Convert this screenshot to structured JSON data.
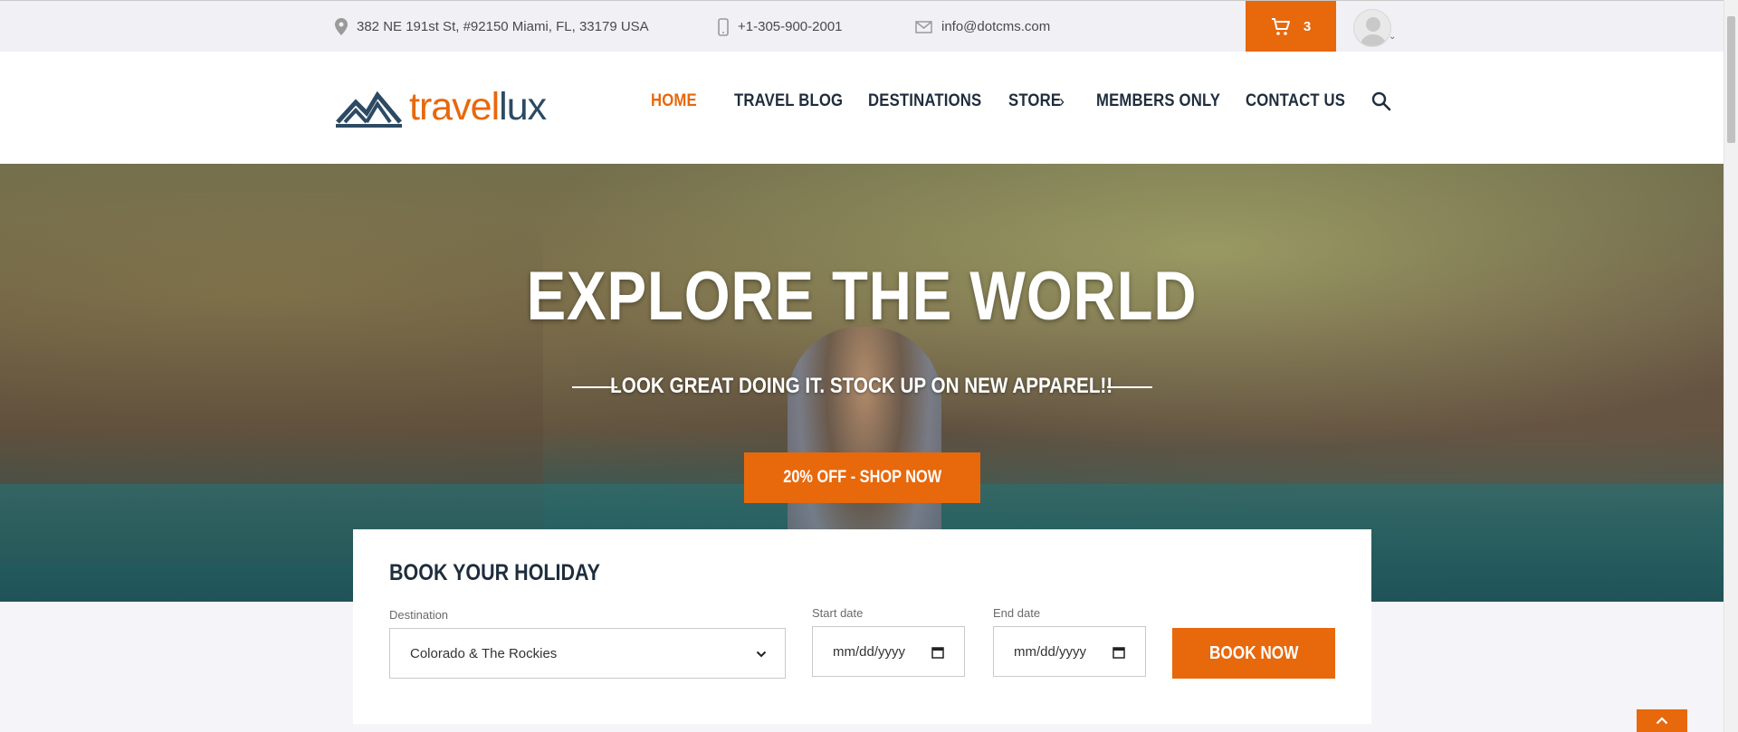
{
  "topbar": {
    "address": "382 NE 191st St, #92150 Miami, FL, 33179 USA",
    "phone": "+1-305-900-2001",
    "email": "info@dotcms.com",
    "cart_count": "3"
  },
  "logo": {
    "part1": "travel",
    "part2": "lux"
  },
  "nav": {
    "items": [
      {
        "label": "HOME"
      },
      {
        "label": "TRAVEL BLOG"
      },
      {
        "label": "DESTINATIONS"
      },
      {
        "label": "STORE"
      },
      {
        "label": "MEMBERS ONLY"
      },
      {
        "label": "CONTACT US"
      }
    ],
    "chevron": "›"
  },
  "hero": {
    "title": "EXPLORE THE WORLD",
    "subtitle": "LOOK GREAT DOING IT. STOCK UP ON NEW APPAREL!!",
    "cta": "20% OFF - SHOP NOW"
  },
  "booking": {
    "title": "BOOK YOUR HOLIDAY",
    "destination_label": "Destination",
    "destination_value": "Colorado & The Rockies",
    "start_label": "Start date",
    "start_placeholder": "mm/dd/yyyy",
    "end_label": "End date",
    "end_placeholder": "mm/dd/yyyy",
    "submit": "BOOK NOW"
  },
  "colors": {
    "accent": "#e8680c",
    "navy": "#2c4a63",
    "text_dark": "#1f2d3d"
  },
  "icons": [
    "location-pin-icon",
    "mobile-phone-icon",
    "envelope-icon",
    "cart-icon",
    "avatar-icon",
    "search-icon",
    "chevron-down-icon",
    "calendar-icon",
    "chevron-up-icon"
  ]
}
